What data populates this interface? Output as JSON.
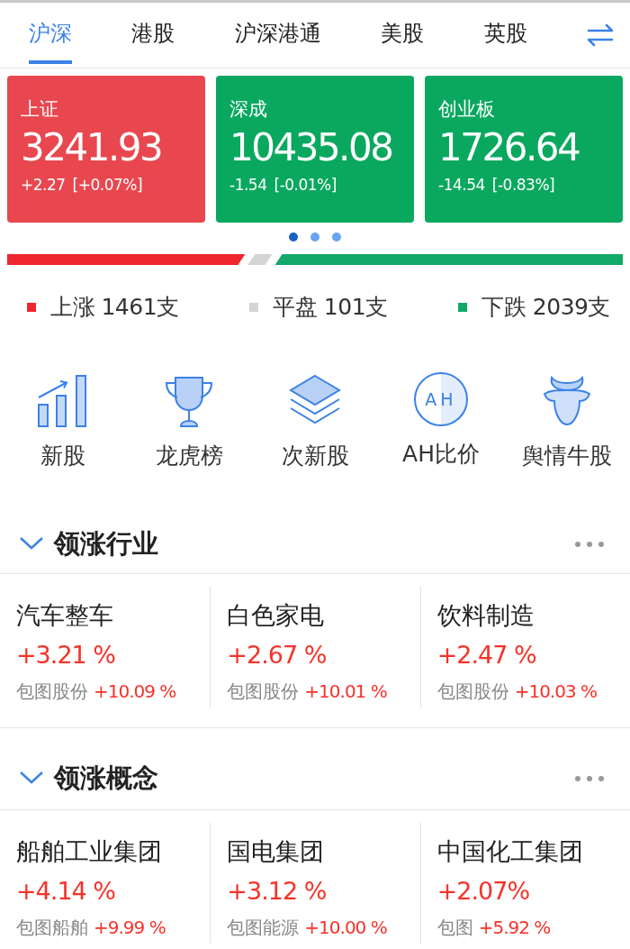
{
  "tabs": [
    {
      "label": "沪深",
      "selected": true
    },
    {
      "label": "港股",
      "selected": false
    },
    {
      "label": "沪深港通",
      "selected": false
    },
    {
      "label": "美股",
      "selected": false
    },
    {
      "label": "英股",
      "selected": false
    }
  ],
  "indices": [
    {
      "name": "上证",
      "value": "3241.93",
      "change": "+2.27",
      "percent": "[+0.07%]",
      "kind": "up"
    },
    {
      "name": "深成",
      "value": "10435.08",
      "change": "-1.54",
      "percent": "[-0.01%]",
      "kind": "down"
    },
    {
      "name": "创业板",
      "value": "1726.64",
      "change": "-14.54",
      "percent": "[-0.83%]",
      "kind": "down"
    }
  ],
  "carousel_dots": [
    {
      "selected": true
    },
    {
      "selected": false
    },
    {
      "selected": false
    }
  ],
  "breadth": [
    {
      "label": "上涨 1461支",
      "color": "#f0262f"
    },
    {
      "label": "平盘 101支",
      "color": "#d4d4d4"
    },
    {
      "label": "下跌 2039支",
      "color": "#12a868"
    }
  ],
  "shortcuts": [
    {
      "label": "新股",
      "kind": "chart"
    },
    {
      "label": "龙虎榜",
      "kind": "trophy"
    },
    {
      "label": "次新股",
      "kind": "layers"
    },
    {
      "label": "AH比价",
      "kind": "badge",
      "badge": "AH"
    },
    {
      "label": "舆情牛股",
      "kind": "bull"
    }
  ],
  "sections": [
    {
      "title": "领涨行业",
      "expanded": true,
      "items": [
        {
          "name": "汽车整车",
          "change": "+3.21 %",
          "leader": "包图股份",
          "leader_change": "+10.09 %"
        },
        {
          "name": "白色家电",
          "change": "+2.67 %",
          "leader": "包图股份",
          "leader_change": "+10.01 %"
        },
        {
          "name": "饮料制造",
          "change": "+2.47 %",
          "leader": "包图股份",
          "leader_change": "+10.03 %"
        }
      ]
    },
    {
      "title": "领涨概念",
      "expanded": true,
      "items": [
        {
          "name": "船舶工业集团",
          "change": "+4.14 %",
          "leader": "包图船舶",
          "leader_change": "+9.99 %"
        },
        {
          "name": "国电集团",
          "change": "+3.12 %",
          "leader": "包图能源",
          "leader_change": "+10.00 %"
        },
        {
          "name": "中国化工集团",
          "change": "+2.07%",
          "leader": "包图",
          "leader_change": "+5.92 %"
        }
      ]
    }
  ]
}
